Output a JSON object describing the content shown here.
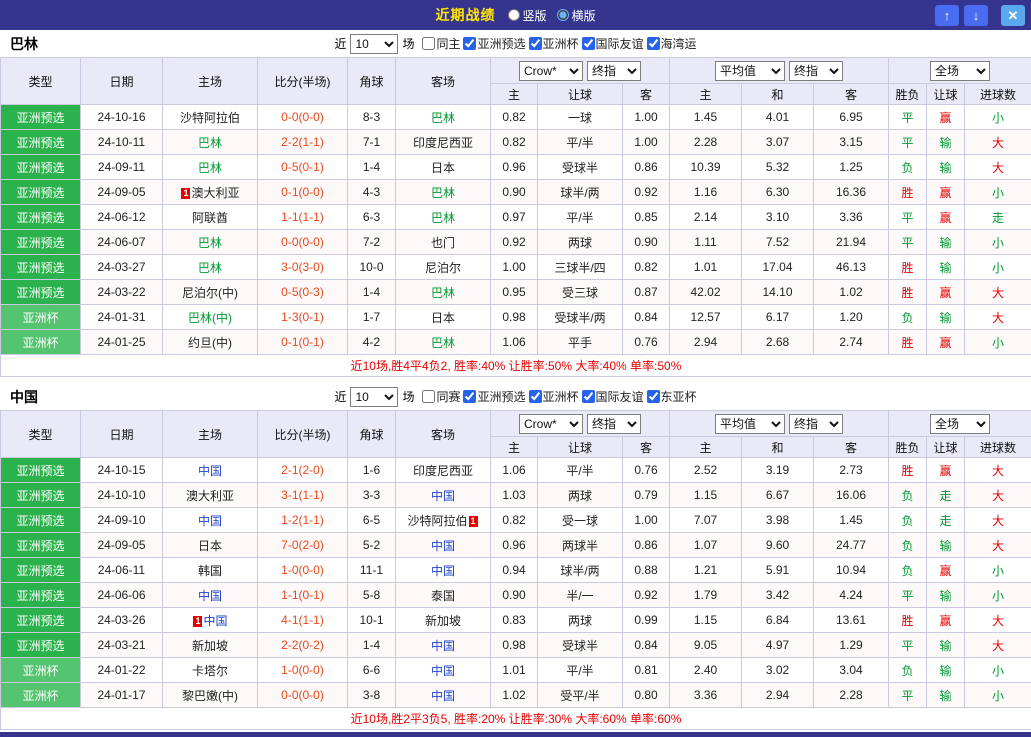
{
  "colors": {
    "topbar-bg": "#35358f",
    "title": "#ffe400",
    "header-bg": "#e9e9f7",
    "border": "#c9c9e0",
    "score": "#e8491d",
    "red": "#e60000",
    "green": "#009933",
    "summary": "#e60000",
    "badge-bg": "#e60000",
    "btn-blue": "#4a6cf0",
    "btn-close": "#5aa8ee",
    "checkbox-accent": "#2563eb",
    "row-alt": "#fdf9f9"
  },
  "type_colors": {
    "亚洲预选": "#2bb24c",
    "亚洲杯": "#55c470"
  },
  "topbar": {
    "title": "近期战绩",
    "vertical_label": "竖版",
    "horizontal_label": "横版",
    "up_icon": "↑",
    "down_icon": "↓",
    "close_icon": "✕"
  },
  "labels": {
    "near": "近",
    "games": "场"
  },
  "table": {
    "type": "类型",
    "date": "日期",
    "home": "主场",
    "score": "比分(半场)",
    "corner": "角球",
    "away": "客场",
    "h": "主",
    "handicap": "让球",
    "a": "客",
    "draw": "和",
    "result": "胜负",
    "handicap_result": "让球",
    "goals": "进球数",
    "dd_crow": "Crow*",
    "dd_final": "终指",
    "dd_avg": "平均值",
    "dd_full": "全场"
  },
  "sections": [
    {
      "team": "巴林",
      "team_color": "#009933",
      "recent_count": "10",
      "checkboxes": [
        {
          "label": "同主",
          "checked": false
        },
        {
          "label": "亚洲预选",
          "checked": true
        },
        {
          "label": "亚洲杯",
          "checked": true
        },
        {
          "label": "国际友谊",
          "checked": true
        },
        {
          "label": "海湾运",
          "checked": true
        }
      ],
      "rows": [
        {
          "type": "亚洲预选",
          "date": "24-10-16",
          "home": "沙特阿拉伯",
          "home_self": false,
          "score": "0-0(0-0)",
          "corner": "8-3",
          "away": "巴林",
          "away_self": true,
          "crow": [
            "0.82",
            "一球",
            "1.00"
          ],
          "avg": [
            "1.45",
            "4.01",
            "6.95"
          ],
          "result": "平",
          "handicap_result": "赢",
          "goals": "小"
        },
        {
          "type": "亚洲预选",
          "date": "24-10-11",
          "home": "巴林",
          "home_self": true,
          "score": "2-2(1-1)",
          "corner": "7-1",
          "away": "印度尼西亚",
          "away_self": false,
          "crow": [
            "0.82",
            "平/半",
            "1.00"
          ],
          "avg": [
            "2.28",
            "3.07",
            "3.15"
          ],
          "result": "平",
          "handicap_result": "输",
          "goals": "大"
        },
        {
          "type": "亚洲预选",
          "date": "24-09-11",
          "home": "巴林",
          "home_self": true,
          "score": "0-5(0-1)",
          "corner": "1-4",
          "away": "日本",
          "away_self": false,
          "crow": [
            "0.96",
            "受球半",
            "0.86"
          ],
          "avg": [
            "10.39",
            "5.32",
            "1.25"
          ],
          "result": "负",
          "handicap_result": "输",
          "goals": "大"
        },
        {
          "type": "亚洲预选",
          "date": "24-09-05",
          "home": "澳大利亚",
          "home_self": false,
          "home_badge": "1",
          "home_badge_pos": "before",
          "score": "0-1(0-0)",
          "corner": "4-3",
          "away": "巴林",
          "away_self": true,
          "crow": [
            "0.90",
            "球半/两",
            "0.92"
          ],
          "avg": [
            "1.16",
            "6.30",
            "16.36"
          ],
          "result": "胜",
          "handicap_result": "赢",
          "goals": "小"
        },
        {
          "type": "亚洲预选",
          "date": "24-06-12",
          "home": "阿联酋",
          "home_self": false,
          "score": "1-1(1-1)",
          "corner": "6-3",
          "away": "巴林",
          "away_self": true,
          "crow": [
            "0.97",
            "平/半",
            "0.85"
          ],
          "avg": [
            "2.14",
            "3.10",
            "3.36"
          ],
          "result": "平",
          "handicap_result": "赢",
          "goals": "走"
        },
        {
          "type": "亚洲预选",
          "date": "24-06-07",
          "home": "巴林",
          "home_self": true,
          "score": "0-0(0-0)",
          "corner": "7-2",
          "away": "也门",
          "away_self": false,
          "crow": [
            "0.92",
            "两球",
            "0.90"
          ],
          "avg": [
            "1.11",
            "7.52",
            "21.94"
          ],
          "result": "平",
          "handicap_result": "输",
          "goals": "小"
        },
        {
          "type": "亚洲预选",
          "date": "24-03-27",
          "home": "巴林",
          "home_self": true,
          "score": "3-0(3-0)",
          "corner": "10-0",
          "away": "尼泊尔",
          "away_self": false,
          "crow": [
            "1.00",
            "三球半/四",
            "0.82"
          ],
          "avg": [
            "1.01",
            "17.04",
            "46.13"
          ],
          "result": "胜",
          "handicap_result": "输",
          "goals": "小"
        },
        {
          "type": "亚洲预选",
          "date": "24-03-22",
          "home": "尼泊尔(中)",
          "home_self": false,
          "score": "0-5(0-3)",
          "corner": "1-4",
          "away": "巴林",
          "away_self": true,
          "crow": [
            "0.95",
            "受三球",
            "0.87"
          ],
          "avg": [
            "42.02",
            "14.10",
            "1.02"
          ],
          "result": "胜",
          "handicap_result": "赢",
          "goals": "大"
        },
        {
          "type": "亚洲杯",
          "date": "24-01-31",
          "home": "巴林(中)",
          "home_self": true,
          "score": "1-3(0-1)",
          "corner": "1-7",
          "away": "日本",
          "away_self": false,
          "crow": [
            "0.98",
            "受球半/两",
            "0.84"
          ],
          "avg": [
            "12.57",
            "6.17",
            "1.20"
          ],
          "result": "负",
          "handicap_result": "输",
          "goals": "大"
        },
        {
          "type": "亚洲杯",
          "date": "24-01-25",
          "home": "约旦(中)",
          "home_self": false,
          "score": "0-1(0-1)",
          "corner": "4-2",
          "away": "巴林",
          "away_self": true,
          "crow": [
            "1.06",
            "平手",
            "0.76"
          ],
          "avg": [
            "2.94",
            "2.68",
            "2.74"
          ],
          "result": "胜",
          "handicap_result": "赢",
          "goals": "小"
        }
      ],
      "summary": "近10场,胜4平4负2, 胜率:40% 让胜率:50% 大率:40% 单率:50%"
    },
    {
      "team": "中国",
      "team_color": "#2244cc",
      "recent_count": "10",
      "checkboxes": [
        {
          "label": "同赛",
          "checked": false
        },
        {
          "label": "亚洲预选",
          "checked": true
        },
        {
          "label": "亚洲杯",
          "checked": true
        },
        {
          "label": "国际友谊",
          "checked": true
        },
        {
          "label": "东亚杯",
          "checked": true
        }
      ],
      "rows": [
        {
          "type": "亚洲预选",
          "date": "24-10-15",
          "home": "中国",
          "home_self": true,
          "score": "2-1(2-0)",
          "corner": "1-6",
          "away": "印度尼西亚",
          "away_self": false,
          "crow": [
            "1.06",
            "平/半",
            "0.76"
          ],
          "avg": [
            "2.52",
            "3.19",
            "2.73"
          ],
          "result": "胜",
          "handicap_result": "赢",
          "goals": "大"
        },
        {
          "type": "亚洲预选",
          "date": "24-10-10",
          "home": "澳大利亚",
          "home_self": false,
          "score": "3-1(1-1)",
          "corner": "3-3",
          "away": "中国",
          "away_self": true,
          "crow": [
            "1.03",
            "两球",
            "0.79"
          ],
          "avg": [
            "1.15",
            "6.67",
            "16.06"
          ],
          "result": "负",
          "handicap_result": "走",
          "goals": "大"
        },
        {
          "type": "亚洲预选",
          "date": "24-09-10",
          "home": "中国",
          "home_self": true,
          "score": "1-2(1-1)",
          "corner": "6-5",
          "away": "沙特阿拉伯",
          "away_self": false,
          "away_badge": "1",
          "away_badge_pos": "after",
          "crow": [
            "0.82",
            "受一球",
            "1.00"
          ],
          "avg": [
            "7.07",
            "3.98",
            "1.45"
          ],
          "result": "负",
          "handicap_result": "走",
          "goals": "大"
        },
        {
          "type": "亚洲预选",
          "date": "24-09-05",
          "home": "日本",
          "home_self": false,
          "score": "7-0(2-0)",
          "corner": "5-2",
          "away": "中国",
          "away_self": true,
          "crow": [
            "0.96",
            "两球半",
            "0.86"
          ],
          "avg": [
            "1.07",
            "9.60",
            "24.77"
          ],
          "result": "负",
          "handicap_result": "输",
          "goals": "大"
        },
        {
          "type": "亚洲预选",
          "date": "24-06-11",
          "home": "韩国",
          "home_self": false,
          "score": "1-0(0-0)",
          "corner": "11-1",
          "away": "中国",
          "away_self": true,
          "crow": [
            "0.94",
            "球半/两",
            "0.88"
          ],
          "avg": [
            "1.21",
            "5.91",
            "10.94"
          ],
          "result": "负",
          "handicap_result": "赢",
          "goals": "小"
        },
        {
          "type": "亚洲预选",
          "date": "24-06-06",
          "home": "中国",
          "home_self": true,
          "score": "1-1(0-1)",
          "corner": "5-8",
          "away": "泰国",
          "away_self": false,
          "crow": [
            "0.90",
            "半/一",
            "0.92"
          ],
          "avg": [
            "1.79",
            "3.42",
            "4.24"
          ],
          "result": "平",
          "handicap_result": "输",
          "goals": "小"
        },
        {
          "type": "亚洲预选",
          "date": "24-03-26",
          "home": "中国",
          "home_self": true,
          "home_badge": "1",
          "home_badge_pos": "before",
          "score": "4-1(1-1)",
          "corner": "10-1",
          "away": "新加坡",
          "away_self": false,
          "crow": [
            "0.83",
            "两球",
            "0.99"
          ],
          "avg": [
            "1.15",
            "6.84",
            "13.61"
          ],
          "result": "胜",
          "handicap_result": "赢",
          "goals": "大"
        },
        {
          "type": "亚洲预选",
          "date": "24-03-21",
          "home": "新加坡",
          "home_self": false,
          "score": "2-2(0-2)",
          "corner": "1-4",
          "away": "中国",
          "away_self": true,
          "crow": [
            "0.98",
            "受球半",
            "0.84"
          ],
          "avg": [
            "9.05",
            "4.97",
            "1.29"
          ],
          "result": "平",
          "handicap_result": "输",
          "goals": "大"
        },
        {
          "type": "亚洲杯",
          "date": "24-01-22",
          "home": "卡塔尔",
          "home_self": false,
          "score": "1-0(0-0)",
          "corner": "6-6",
          "away": "中国",
          "away_self": true,
          "crow": [
            "1.01",
            "平/半",
            "0.81"
          ],
          "avg": [
            "2.40",
            "3.02",
            "3.04"
          ],
          "result": "负",
          "handicap_result": "输",
          "goals": "小"
        },
        {
          "type": "亚洲杯",
          "date": "24-01-17",
          "home": "黎巴嫩(中)",
          "home_self": false,
          "score": "0-0(0-0)",
          "corner": "3-8",
          "away": "中国",
          "away_self": true,
          "crow": [
            "1.02",
            "受平/半",
            "0.80"
          ],
          "avg": [
            "3.36",
            "2.94",
            "2.28"
          ],
          "result": "平",
          "handicap_result": "输",
          "goals": "小"
        }
      ],
      "summary": "近10场,胜2平3负5, 胜率:20% 让胜率:30% 大率:60% 单率:60%"
    }
  ]
}
